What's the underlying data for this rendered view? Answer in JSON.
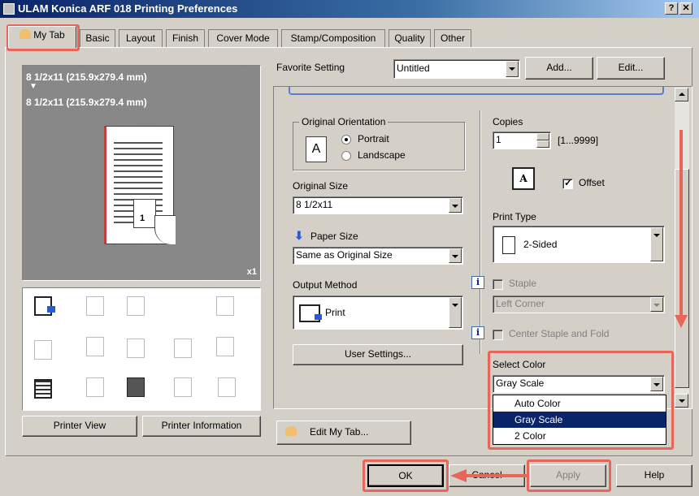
{
  "window": {
    "title": "ULAM Konica ARF 018 Printing Preferences",
    "help_btn": "?",
    "close_btn": "✕"
  },
  "tabs": [
    "My Tab",
    "Basic",
    "Layout",
    "Finish",
    "Cover Mode",
    "Stamp/Composition",
    "Quality",
    "Other"
  ],
  "preview": {
    "paper_line1": "8 1/2x11 (215.9x279.4 mm)",
    "arrow": "▼",
    "paper_line2": "8 1/2x11 (215.9x279.4 mm)",
    "copies_marker": "x1",
    "page_number": "1"
  },
  "left_buttons": {
    "printer_view": "Printer View",
    "printer_information": "Printer Information"
  },
  "favorite": {
    "label": "Favorite Setting",
    "value": "Untitled",
    "add": "Add...",
    "edit": "Edit..."
  },
  "orientation": {
    "group": "Original Orientation",
    "portrait": "Portrait",
    "landscape": "Landscape",
    "selected": "Portrait",
    "icon_letter": "A"
  },
  "original_size": {
    "label": "Original Size",
    "value": "8 1/2x11"
  },
  "paper_size": {
    "label": "Paper Size",
    "value": "Same as Original Size"
  },
  "output_method": {
    "label": "Output Method",
    "value": "Print"
  },
  "user_settings": "User Settings...",
  "edit_my_tab": "Edit My Tab...",
  "copies": {
    "label": "Copies",
    "value": "1",
    "range": "[1...9999]",
    "offset": "Offset",
    "offset_checked": true
  },
  "print_type": {
    "label": "Print Type",
    "value": "2-Sided"
  },
  "staple": {
    "label": "Staple",
    "value": "Left Corner"
  },
  "center_staple": "Center Staple and Fold",
  "select_color": {
    "label": "Select Color",
    "value": "Gray Scale",
    "options": [
      "Auto Color",
      "Gray Scale",
      "2 Color"
    ],
    "highlighted": "Gray Scale"
  },
  "bottom_buttons": {
    "ok": "OK",
    "cancel": "Cancel",
    "apply": "Apply",
    "help": "Help"
  },
  "colors": {
    "highlight": "#e8655a",
    "selection": "#0a246a"
  }
}
